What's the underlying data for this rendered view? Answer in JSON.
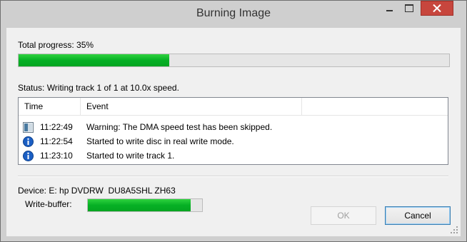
{
  "window": {
    "title": "Burning Image"
  },
  "progress": {
    "label": "Total progress: 35%",
    "value": 0.35
  },
  "status": {
    "text": "Status: Writing track 1 of 1 at 10.0x speed."
  },
  "log": {
    "headers": {
      "time": "Time",
      "event": "Event"
    },
    "rows": [
      {
        "icon": "warning-icon",
        "time": "11:22:49",
        "event": "Warning: The DMA speed test has been skipped."
      },
      {
        "icon": "info-icon",
        "time": "11:22:54",
        "event": "Started to write disc in real write mode."
      },
      {
        "icon": "info-icon",
        "time": "11:23:10",
        "event": "Started to write track 1."
      }
    ]
  },
  "device": {
    "text": "Device: E: hp DVDRW  DU8A5SHL ZH63"
  },
  "buffer": {
    "label": "Write-buffer:",
    "value": 0.9
  },
  "buttons": {
    "ok": "OK",
    "cancel": "Cancel"
  },
  "colors": {
    "progress": "#06b025",
    "info": "#1b5fc4",
    "close": "#c7463d"
  }
}
